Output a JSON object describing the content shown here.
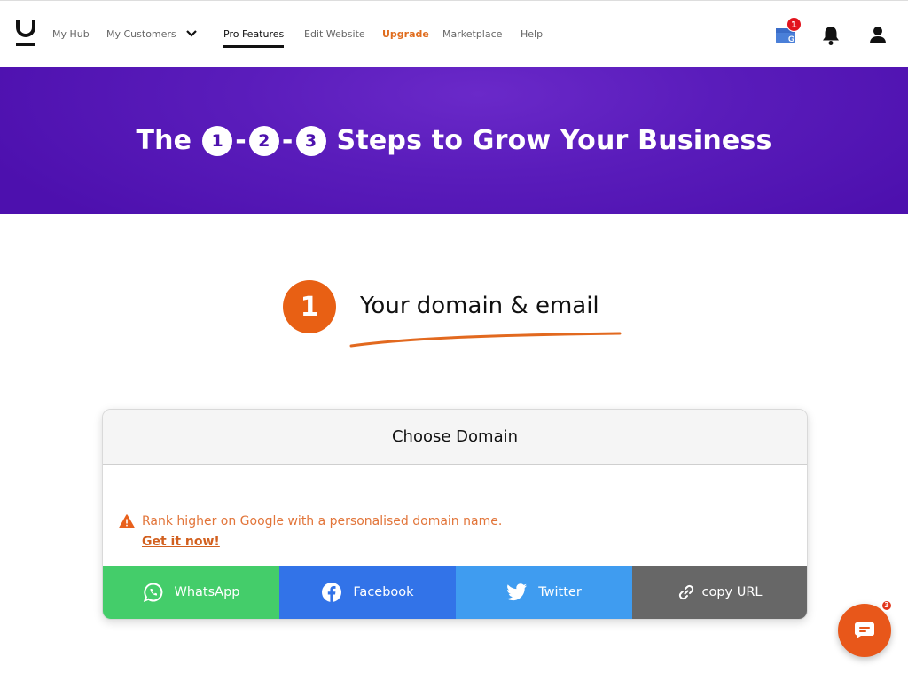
{
  "nav": {
    "items": [
      {
        "label": "My Hub",
        "state": "normal"
      },
      {
        "label": "My Customers",
        "state": "dropdown"
      },
      {
        "label": "Pro Features",
        "state": "active"
      },
      {
        "label": "Edit Website",
        "state": "normal"
      },
      {
        "label": "Upgrade",
        "state": "highlight"
      },
      {
        "label": "Marketplace",
        "state": "normal"
      },
      {
        "label": "Help",
        "state": "normal"
      }
    ],
    "notification_badge": "1",
    "icons": [
      "logo-icon",
      "chevron-down-icon",
      "google-business-icon",
      "bell-icon",
      "user-icon"
    ]
  },
  "hero": {
    "prefix": "The",
    "steps": [
      "1",
      "2",
      "3"
    ],
    "separator": "-",
    "suffix": "Steps to Grow Your Business"
  },
  "section": {
    "step_number": "1",
    "title": "Your domain & email"
  },
  "card": {
    "title": "Choose Domain",
    "warning": "Rank higher on Google with a personalised domain name.",
    "cta": "Get it now!",
    "share_buttons": [
      {
        "label": "WhatsApp",
        "icon": "whatsapp-icon",
        "color": "#44cd6a"
      },
      {
        "label": "Facebook",
        "icon": "facebook-icon",
        "color": "#3273e8"
      },
      {
        "label": "Twitter",
        "icon": "twitter-icon",
        "color": "#3f9cf0"
      },
      {
        "label": "copy URL",
        "icon": "link-icon",
        "color": "#676767"
      }
    ]
  },
  "chat": {
    "badge": "3"
  },
  "colors": {
    "accent": "#e86014",
    "hero_bg": "#5a1cbb",
    "upgrade": "#e06d1f"
  }
}
